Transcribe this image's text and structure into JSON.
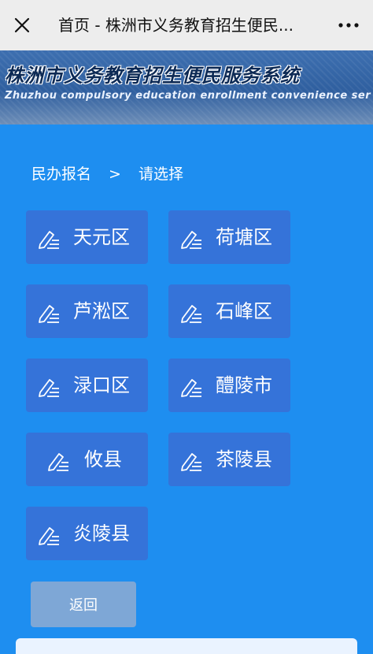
{
  "topbar": {
    "title": "首页 - 株洲市义务教育招生便民...",
    "close_icon": "close-icon",
    "more_icon": "more-icon"
  },
  "banner": {
    "title_cn": "株洲市义务教育招生便民服务系统",
    "title_en": "Zhuzhou compulsory education enrollment convenience ser"
  },
  "breadcrumb": {
    "root": "民办报名",
    "separator": ">",
    "current": "请选择"
  },
  "districts": [
    {
      "label": "天元区",
      "icon": "edit-icon"
    },
    {
      "label": "荷塘区",
      "icon": "edit-icon"
    },
    {
      "label": "芦淞区",
      "icon": "edit-icon"
    },
    {
      "label": "石峰区",
      "icon": "edit-icon"
    },
    {
      "label": "渌口区",
      "icon": "edit-icon"
    },
    {
      "label": "醴陵市",
      "icon": "edit-icon"
    },
    {
      "label": "攸县",
      "icon": "edit-icon"
    },
    {
      "label": "茶陵县",
      "icon": "edit-icon"
    },
    {
      "label": "炎陵县",
      "icon": "edit-icon"
    }
  ],
  "back_button": {
    "label": "返回"
  },
  "colors": {
    "page_bg": "#1e8ef0",
    "button_bg": "#3573d9",
    "back_bg": "#7ea7d6"
  }
}
